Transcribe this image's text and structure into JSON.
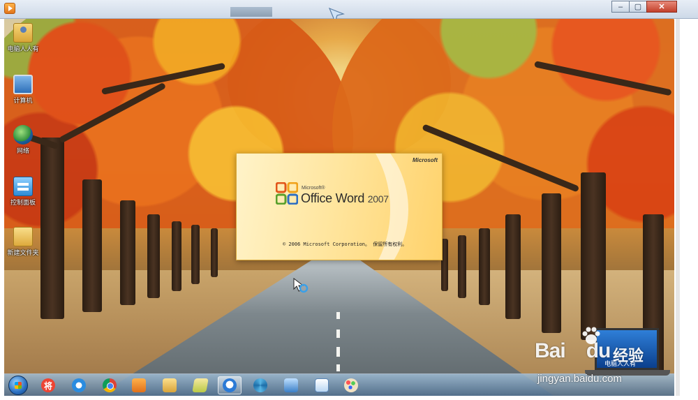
{
  "window": {
    "buttons": {
      "minimize": "–",
      "maximize": "▢",
      "close": "✕"
    }
  },
  "desktop": {
    "icons": [
      {
        "label": "电脑人人有",
        "icon": "user-folder-icon"
      },
      {
        "label": "计算机",
        "icon": "computer-icon"
      },
      {
        "label": "网络",
        "icon": "network-icon"
      },
      {
        "label": "控制面板",
        "icon": "control-panel-icon"
      },
      {
        "label": "新建文件夹",
        "icon": "folder-icon"
      }
    ]
  },
  "splash": {
    "vendor": "Microsoft",
    "product_prefix": "Microsoft®",
    "product_name": "Office Word",
    "product_year": "2007",
    "copyright": "© 2006 Microsoft Corporation。 保留所有权利。"
  },
  "taskbar": {
    "items": [
      {
        "icon": "start-orb-icon"
      },
      {
        "icon": "jiang-icon",
        "text": "将"
      },
      {
        "icon": "internet-explorer-icon"
      },
      {
        "icon": "chrome-icon"
      },
      {
        "icon": "media-player-icon"
      },
      {
        "icon": "file-explorer-icon"
      },
      {
        "icon": "folder-icon"
      },
      {
        "icon": "qq-browser-icon",
        "active": true
      },
      {
        "icon": "settings-gear-icon"
      },
      {
        "icon": "remote-desktop-icon"
      },
      {
        "icon": "document-icon"
      },
      {
        "icon": "paint-icon"
      }
    ]
  },
  "watermark": {
    "brand": "Bai",
    "brand_suffix": "du",
    "cn_text": "经验",
    "laptop_text": "电脑人人有",
    "url": "jingyan.baidu.com"
  },
  "colors": {
    "splash_gold": "#ffd26b",
    "taskbar": "#6d8fae",
    "close_button": "#c2402b"
  }
}
